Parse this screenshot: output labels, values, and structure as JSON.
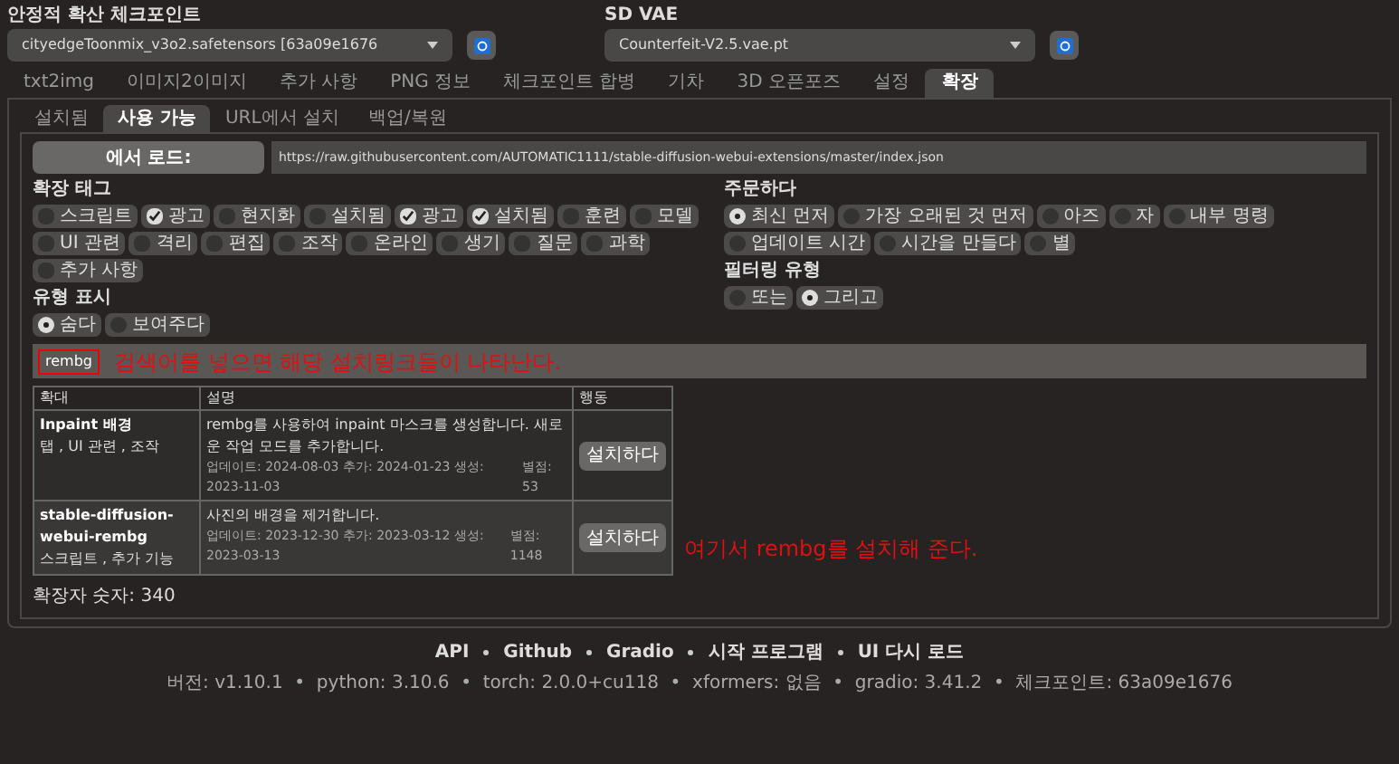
{
  "checkpoint": {
    "label": "안정적 확산 체크포인트",
    "value": "cityedgeToonmix_v3o2.safetensors [63a09e1676"
  },
  "vae": {
    "label": "SD VAE",
    "value": "Counterfeit-V2.5.vae.pt"
  },
  "tabs": [
    {
      "label": "txt2img",
      "selected": false
    },
    {
      "label": "이미지2이미지",
      "selected": false
    },
    {
      "label": "추가 사항",
      "selected": false
    },
    {
      "label": "PNG 정보",
      "selected": false
    },
    {
      "label": "체크포인트 합병",
      "selected": false
    },
    {
      "label": "기차",
      "selected": false
    },
    {
      "label": "3D 오픈포즈",
      "selected": false
    },
    {
      "label": "설정",
      "selected": false
    },
    {
      "label": "확장",
      "selected": true
    }
  ],
  "subtabs": [
    {
      "label": "설치됨",
      "selected": false
    },
    {
      "label": "사용 가능",
      "selected": true
    },
    {
      "label": "URL에서 설치",
      "selected": false
    },
    {
      "label": "백업/복원",
      "selected": false
    }
  ],
  "load_button": "에서 로드:",
  "url": "https://raw.githubusercontent.com/AUTOMATIC1111/stable-diffusion-webui-extensions/master/index.json",
  "tags": {
    "label": "확장 태그",
    "items": [
      {
        "label": "스크립트",
        "checked": false
      },
      {
        "label": "광고",
        "checked": true
      },
      {
        "label": "현지화",
        "checked": false
      },
      {
        "label": "설치됨",
        "checked": false
      },
      {
        "label": "광고",
        "checked": true
      },
      {
        "label": "설치됨",
        "checked": true
      },
      {
        "label": "훈련",
        "checked": false
      },
      {
        "label": "모델",
        "checked": false
      },
      {
        "label": "UI 관련",
        "checked": false
      },
      {
        "label": "격리",
        "checked": false
      },
      {
        "label": "편집",
        "checked": false
      },
      {
        "label": "조작",
        "checked": false
      },
      {
        "label": "온라인",
        "checked": false
      },
      {
        "label": "생기",
        "checked": false
      },
      {
        "label": "질문",
        "checked": false
      },
      {
        "label": "과학",
        "checked": false
      },
      {
        "label": "추가 사항",
        "checked": false
      }
    ]
  },
  "sort": {
    "label": "주문하다",
    "items": [
      {
        "label": "최신 먼저",
        "selected": true
      },
      {
        "label": "가장 오래된 것 먼저",
        "selected": false
      },
      {
        "label": "아즈",
        "selected": false
      },
      {
        "label": "자",
        "selected": false
      },
      {
        "label": "내부 명령",
        "selected": false
      },
      {
        "label": "업데이트 시간",
        "selected": false
      },
      {
        "label": "시간을 만들다",
        "selected": false
      },
      {
        "label": "별",
        "selected": false
      }
    ]
  },
  "show_type": {
    "label": "유형 표시",
    "items": [
      {
        "label": "숨다",
        "selected": true
      },
      {
        "label": "보여주다",
        "selected": false
      }
    ]
  },
  "filter_type": {
    "label": "필터링 유형",
    "items": [
      {
        "label": "또는",
        "selected": false
      },
      {
        "label": "그리고",
        "selected": true
      }
    ]
  },
  "search": {
    "value": "rembg",
    "note": "검색어를 넣으면 해당 설치링크들이 나타난다."
  },
  "table": {
    "columns": [
      "확대",
      "설명",
      "행동"
    ],
    "rows": [
      {
        "name": "Inpaint 배경",
        "tags": "탭 , UI 관련 , 조작",
        "description": "rembg를 사용하여 inpaint 마스크를 생성합니다. 새로운 작업 모드를 추가합니다.",
        "dates": "업데이트: 2024-08-03 추가: 2024-01-23 생성: 2023-11-03",
        "stars": "별점: 53",
        "action": "설치하다"
      },
      {
        "name": "stable-diffusion-webui-rembg",
        "tags": "스크립트 , 추가 기능",
        "description": "사진의 배경을 제거합니다.",
        "dates": "업데이트: 2023-12-30 추가: 2023-03-12 생성: 2023-03-13",
        "stars": "별점: 1148",
        "action": "설치하다"
      }
    ]
  },
  "install_note": "여기서 rembg를 설치해 준다.",
  "count": "확장자 숫자: 340",
  "footer": {
    "links": [
      "API",
      "Github",
      "Gradio",
      "시작 프로그램",
      "UI 다시 로드"
    ],
    "version": "버전: v1.10.1  •  python: 3.10.6  •  torch: 2.0.0+cu118  •  xformers: 없음  •  gradio: 3.41.2  •  체크포인트: 63a09e1676"
  }
}
